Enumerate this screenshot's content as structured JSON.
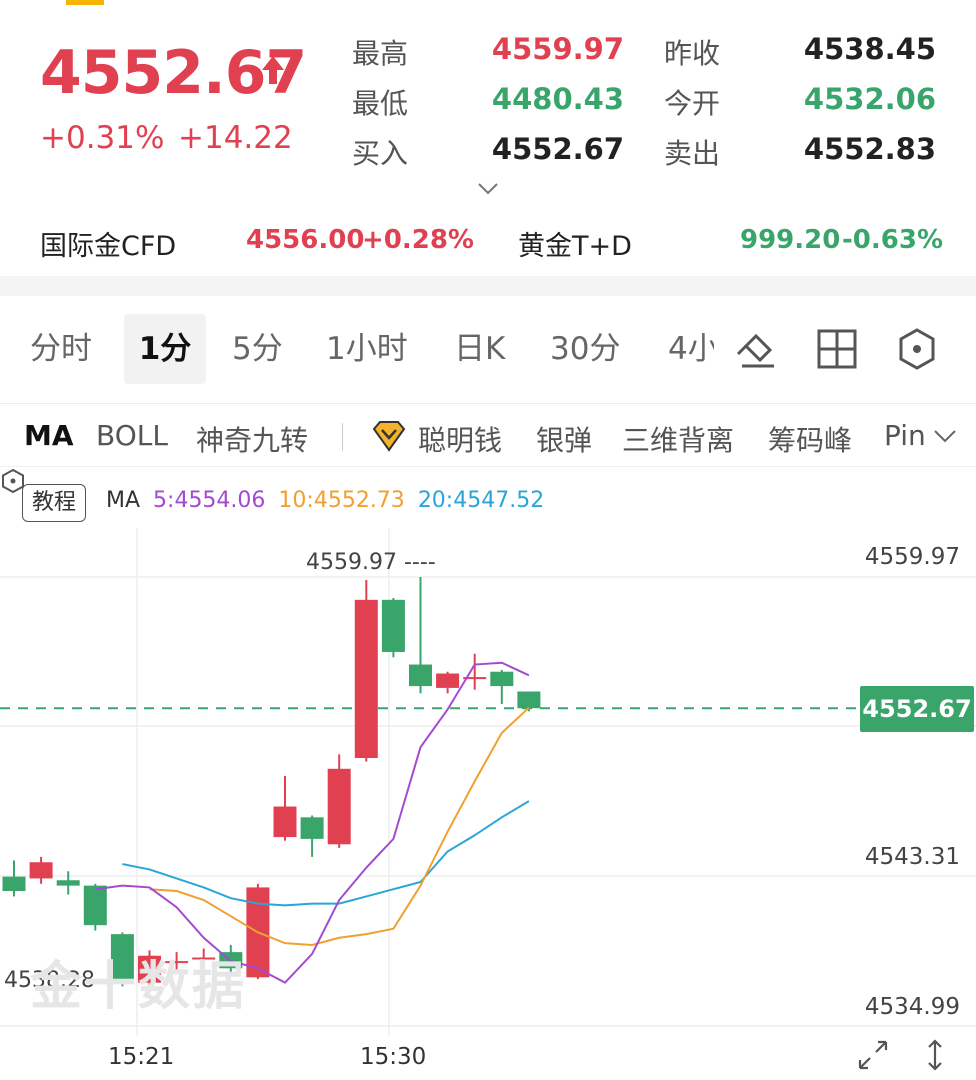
{
  "quote": {
    "price": "4552.67",
    "change_pct": "+0.31%",
    "change_abs": "+14.22",
    "high_label": "最高",
    "high": "4559.97",
    "low_label": "最低",
    "low": "4480.43",
    "bid_label": "买入",
    "bid": "4552.67",
    "prev_close_label": "昨收",
    "prev_close": "4538.45",
    "open_label": "今开",
    "open": "4532.06",
    "ask_label": "卖出",
    "ask": "4552.83"
  },
  "related": [
    {
      "name": "国际金CFD",
      "price": "4556.00",
      "change": "+0.28%"
    },
    {
      "name": "黄金T+D",
      "price": "999.20",
      "change": "-0.63%"
    }
  ],
  "tabs": [
    "分时",
    "1分",
    "5分",
    "1小时",
    "日K",
    "30分",
    "4小"
  ],
  "active_tab": "1分",
  "indicators": [
    "MA",
    "BOLL",
    "神奇九转",
    "聪明钱",
    "银弹",
    "三维背离",
    "筹码峰",
    "Pin"
  ],
  "chart_controls": {
    "tutorial_label": "教程",
    "ma_label": "MA",
    "ma5_label": "5:4554.06",
    "ma10_label": "10:4552.73",
    "ma20_label": "20:4547.52"
  },
  "chart_labels": {
    "y_top": "4559.97",
    "y_mid": "4543.31",
    "y_bottom": "4534.99",
    "current": "4552.67",
    "high_mark": "4559.97 ----",
    "low_mark": "4538.28 ----",
    "x_ticks": [
      "15:21",
      "15:30"
    ],
    "watermark": "金十数据"
  },
  "colors": {
    "up": "#e04050",
    "down": "#3aa56b",
    "ma5": "#a24bd0",
    "ma10": "#f0a030",
    "ma20": "#2aa5d8"
  },
  "chart_data": {
    "type": "candlestick",
    "price_range": [
      4534.99,
      4559.97
    ],
    "candles": [
      {
        "o": 4543.3,
        "c": 4542.5,
        "h": 4544.2,
        "l": 4542.2
      },
      {
        "o": 4543.2,
        "c": 4544.1,
        "h": 4544.4,
        "l": 4542.9
      },
      {
        "o": 4543.1,
        "c": 4542.8,
        "h": 4543.6,
        "l": 4542.3
      },
      {
        "o": 4542.8,
        "c": 4540.6,
        "h": 4542.9,
        "l": 4540.3
      },
      {
        "o": 4540.1,
        "c": 4537.4,
        "h": 4540.2,
        "l": 4537.2
      },
      {
        "o": 4537.4,
        "c": 4538.9,
        "h": 4539.2,
        "l": 4537.0
      },
      {
        "o": 4538.6,
        "c": 4538.6,
        "h": 4539.1,
        "l": 4538.0
      },
      {
        "o": 4538.8,
        "c": 4538.8,
        "h": 4539.3,
        "l": 4538.1
      },
      {
        "o": 4539.1,
        "c": 4538.2,
        "h": 4539.5,
        "l": 4538.0
      },
      {
        "o": 4537.7,
        "c": 4542.7,
        "h": 4542.9,
        "l": 4537.6
      },
      {
        "o": 4545.5,
        "c": 4547.2,
        "h": 4548.9,
        "l": 4545.3
      },
      {
        "o": 4546.6,
        "c": 4545.4,
        "h": 4546.7,
        "l": 4544.4
      },
      {
        "o": 4545.1,
        "c": 4549.3,
        "h": 4550.1,
        "l": 4544.9
      },
      {
        "o": 4549.9,
        "c": 4558.7,
        "h": 4559.8,
        "l": 4549.7
      },
      {
        "o": 4558.7,
        "c": 4555.8,
        "h": 4558.8,
        "l": 4555.5
      },
      {
        "o": 4555.1,
        "c": 4553.9,
        "h": 4559.97,
        "l": 4553.5
      },
      {
        "o": 4553.8,
        "c": 4554.6,
        "h": 4554.7,
        "l": 4553.5
      },
      {
        "o": 4554.4,
        "c": 4554.4,
        "h": 4555.7,
        "l": 4553.7
      },
      {
        "o": 4554.7,
        "c": 4553.9,
        "h": 4554.8,
        "l": 4552.9
      },
      {
        "o": 4553.6,
        "c": 4552.67,
        "h": 4553.6,
        "l": 4552.5
      }
    ],
    "ma5": [
      4542.6,
      4542.8,
      4542.7,
      4541.6,
      4539.9,
      4538.6,
      4538.2,
      4537.4,
      4539.0,
      4542.0,
      4543.8,
      4545.4,
      4550.5,
      4552.6,
      4555.1,
      4555.2,
      4554.5
    ],
    "ma10": [
      4542.6,
      4542.5,
      4542.0,
      4541.1,
      4540.2,
      4539.6,
      4539.5,
      4539.9,
      4540.1,
      4540.4,
      4542.8,
      4545.8,
      4548.6,
      4551.3,
      4552.7
    ],
    "ma20": [
      4544.0,
      4543.7,
      4543.2,
      4542.7,
      4542.1,
      4541.8,
      4541.7,
      4541.8,
      4541.8,
      4542.2,
      4542.6,
      4543.0,
      4544.7,
      4545.6,
      4546.6,
      4547.5
    ]
  }
}
